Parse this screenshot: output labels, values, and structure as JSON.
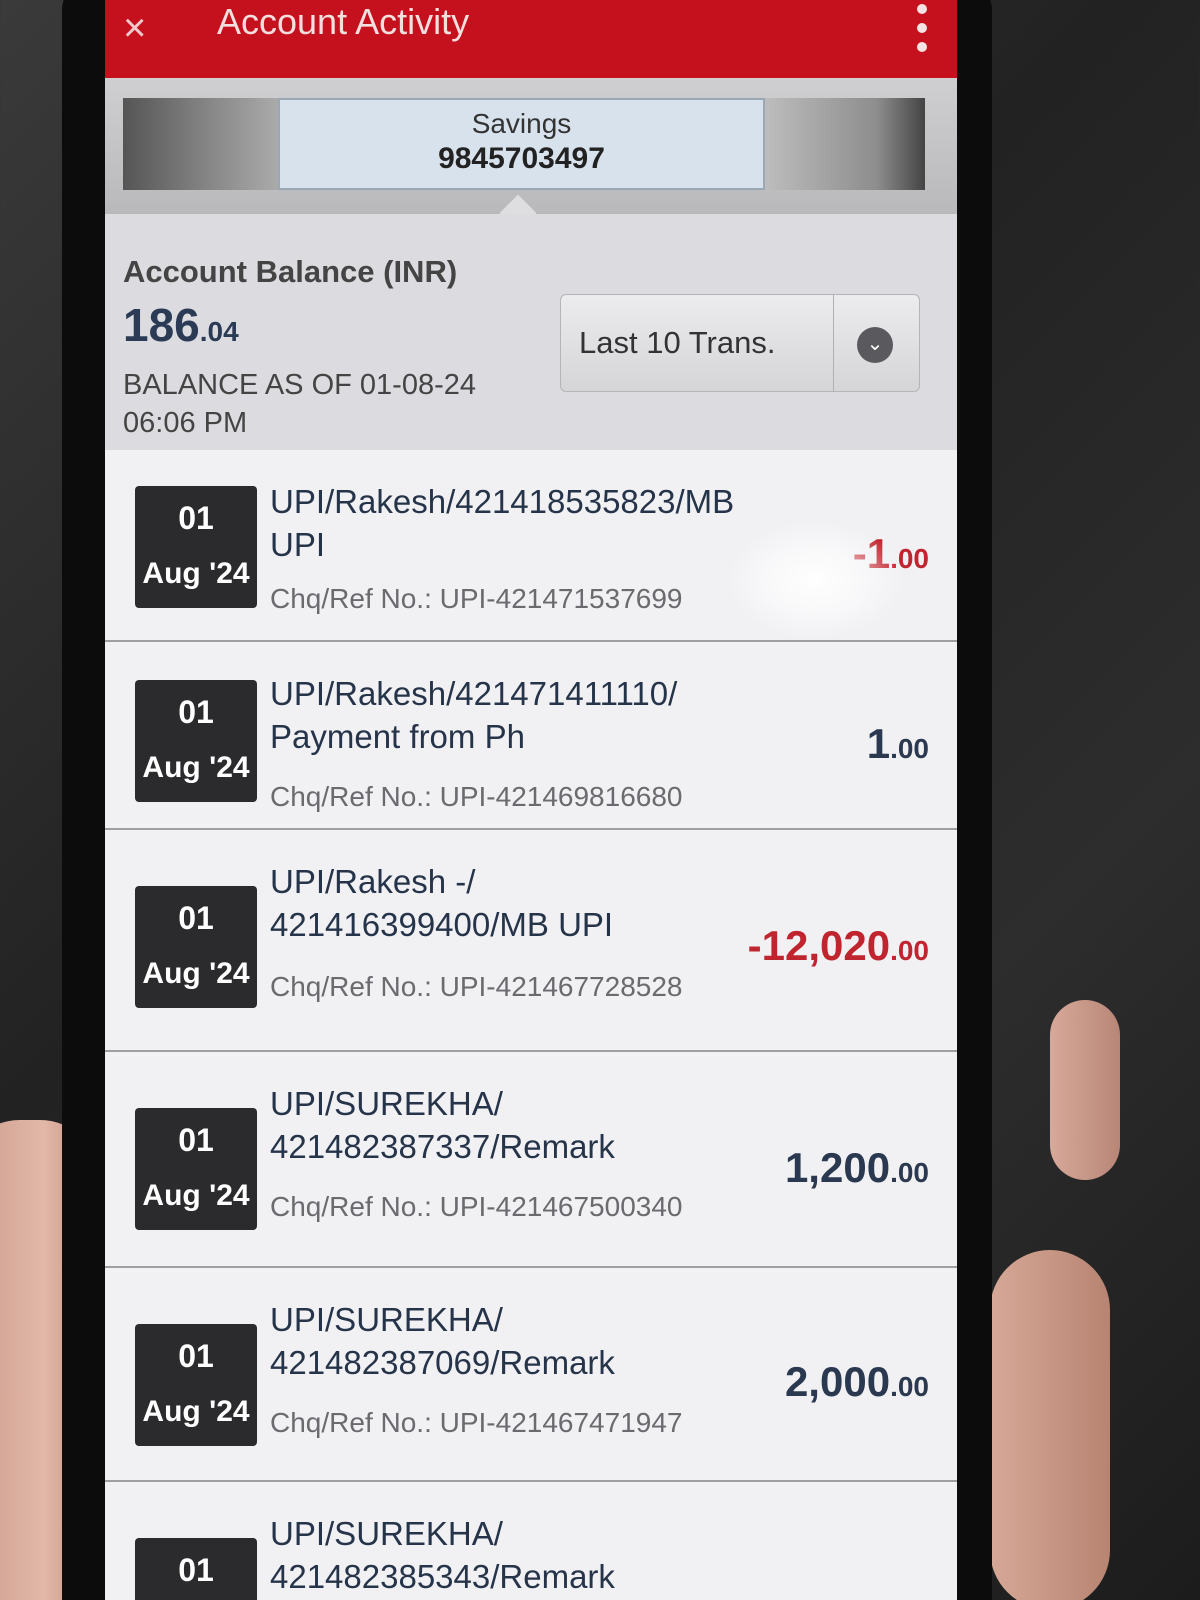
{
  "header": {
    "back_icon": "×",
    "title": "Account Activity"
  },
  "account": {
    "type": "Savings",
    "number": "9845703497"
  },
  "balance": {
    "label": "Account Balance (INR)",
    "amount_main": "186",
    "amount_decimal": ".04",
    "as_of": "BALANCE AS OF 01-08-24 06:06 PM"
  },
  "filter": {
    "selected": "Last 10 Trans."
  },
  "transactions": [
    {
      "day": "01",
      "month": "Aug '24",
      "description": "UPI/Rakesh/421418535823/MB UPI",
      "ref": "Chq/Ref No.: UPI-421471537699",
      "amount_main": "-1",
      "amount_decimal": ".00",
      "direction": "debit"
    },
    {
      "day": "01",
      "month": "Aug '24",
      "description": "UPI/Rakesh/421471411110/ Payment from Ph",
      "ref": "Chq/Ref No.: UPI-421469816680",
      "amount_main": "1",
      "amount_decimal": ".00",
      "direction": "credit"
    },
    {
      "day": "01",
      "month": "Aug '24",
      "description": "UPI/Rakesh -/ 421416399400/MB UPI",
      "ref": "Chq/Ref No.: UPI-421467728528",
      "amount_main": "-12,020",
      "amount_decimal": ".00",
      "direction": "debit"
    },
    {
      "day": "01",
      "month": "Aug '24",
      "description": "UPI/SUREKHA/ 421482387337/Remark",
      "ref": "Chq/Ref No.: UPI-421467500340",
      "amount_main": "1,200",
      "amount_decimal": ".00",
      "direction": "credit"
    },
    {
      "day": "01",
      "month": "Aug '24",
      "description": "UPI/SUREKHA/ 421482387069/Remark",
      "ref": "Chq/Ref No.: UPI-421467471947",
      "amount_main": "2,000",
      "amount_decimal": ".00",
      "direction": "credit"
    },
    {
      "day": "01",
      "month": "",
      "description": "UPI/SUREKHA/ 421482385343/Remark",
      "ref": "",
      "amount_main": "",
      "amount_decimal": "",
      "direction": "credit"
    }
  ],
  "colors": {
    "brand_red": "#c5101d",
    "debit": "#c0242e",
    "credit": "#2a3850"
  }
}
